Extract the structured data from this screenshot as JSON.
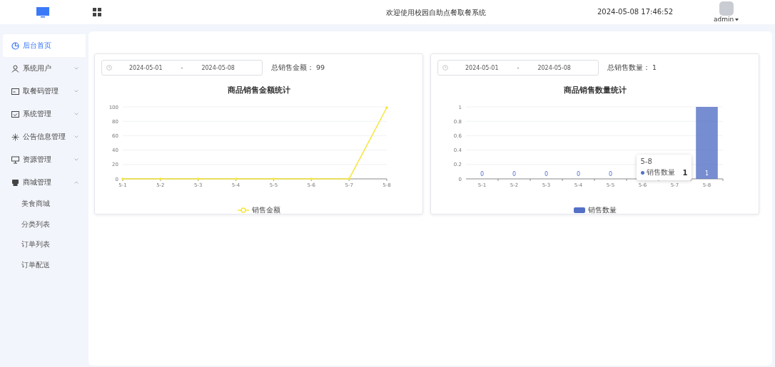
{
  "header": {
    "title": "欢迎使用校园自助点餐取餐系统",
    "datetime": "2024-05-08 17:46:52",
    "user": "admin"
  },
  "sidebar": {
    "items": [
      {
        "label": "后台首页",
        "selected": true
      },
      {
        "label": "系统用户",
        "selected": false,
        "expanded": false
      },
      {
        "label": "取餐码管理",
        "selected": false,
        "expanded": false
      },
      {
        "label": "系统管理",
        "selected": false,
        "expanded": false
      },
      {
        "label": "公告信息管理",
        "selected": false,
        "expanded": false
      },
      {
        "label": "资源管理",
        "selected": false,
        "expanded": false
      },
      {
        "label": "商城管理",
        "selected": false,
        "expanded": true,
        "children": [
          {
            "label": "美食商城",
            "selected": false
          },
          {
            "label": "分类列表",
            "selected": false
          },
          {
            "label": "订单列表",
            "selected": false
          },
          {
            "label": "订单配送",
            "selected": false
          }
        ]
      }
    ]
  },
  "cards": [
    {
      "start_date": "2024-05-01",
      "separator": "-",
      "end_date": "2024-05-08",
      "total_label": "总销售金额：",
      "total_value": "99",
      "chart_data": {
        "type": "line",
        "title": "商品销售金额统计",
        "categories": [
          "5-1",
          "5-2",
          "5-3",
          "5-4",
          "5-5",
          "5-6",
          "5-7",
          "5-8"
        ],
        "series": [
          {
            "name": "销售金额",
            "color": "#f5e63a",
            "values": [
              0,
              0,
              0,
              0,
              0,
              0,
              0,
              99
            ]
          }
        ],
        "ylim": [
          0,
          100
        ],
        "yticks": [
          0,
          20,
          40,
          60,
          80,
          100
        ],
        "grid": true
      }
    },
    {
      "start_date": "2024-05-01",
      "separator": "-",
      "end_date": "2024-05-08",
      "total_label": "总销售数量：",
      "total_value": "1",
      "chart_data": {
        "type": "bar",
        "title": "商品销售数量统计",
        "categories": [
          "5-1",
          "5-2",
          "5-3",
          "5-4",
          "5-5",
          "5-6",
          "5-7",
          "5-8"
        ],
        "series": [
          {
            "name": "销售数量",
            "color": "#5470c6",
            "values": [
              0,
              0,
              0,
              0,
              0,
              0,
              0,
              1
            ]
          }
        ],
        "ylim": [
          0,
          1
        ],
        "yticks": [
          {
            "value": 0,
            "label": "0"
          },
          {
            "value": 0.2,
            "label": "0.2"
          },
          {
            "value": 0.4,
            "label": "0.4"
          },
          {
            "value": 0.6,
            "label": "0.6"
          },
          {
            "value": 0.8,
            "label": "0.8"
          },
          {
            "value": 1,
            "label": "1"
          }
        ],
        "grid": true,
        "value_labels": [
          "0",
          "0",
          "0",
          "0",
          "0",
          null,
          null,
          "1"
        ]
      },
      "tooltip": {
        "category": "5-8",
        "series_name": "销售数量",
        "value": "1"
      }
    }
  ]
}
